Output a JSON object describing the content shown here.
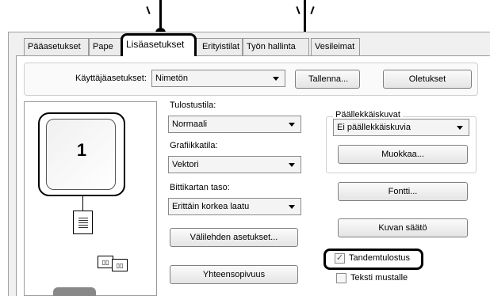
{
  "tabs": [
    {
      "label": "Pääasetukset"
    },
    {
      "label": "Pape"
    },
    {
      "label": "Lisäasetukset"
    },
    {
      "label": "Erityistilat"
    },
    {
      "label": "Työn hallinta"
    },
    {
      "label": "Vesileimat"
    }
  ],
  "user_settings": {
    "label": "Käyttäjäasetukset:",
    "value": "Nimetön",
    "save_button": "Tallenna...",
    "defaults_button": "Oletukset"
  },
  "preview": {
    "page_number": "1"
  },
  "print_mode": {
    "label": "Tulostustila:",
    "value": "Normaali"
  },
  "graphics_mode": {
    "label": "Grafiikkatila:",
    "value": "Vektori"
  },
  "bitmap_level": {
    "label": "Bittikartan taso:",
    "value": "Erittäin korkea laatu"
  },
  "tab_settings_button": "Välilehden asetukset...",
  "compatibility_button": "Yhteensopivuus",
  "overlays": {
    "title": "Päällekkäiskuvat",
    "value": "Ei päällekkäiskuvia",
    "edit_button": "Muokkaa..."
  },
  "font_button": "Fontti...",
  "image_adjust_button": "Kuvan säätö",
  "tandem_print": {
    "label": "Tandemtulostus",
    "checked": true
  },
  "text_black": {
    "label": "Teksti mustalle",
    "checked": false
  }
}
